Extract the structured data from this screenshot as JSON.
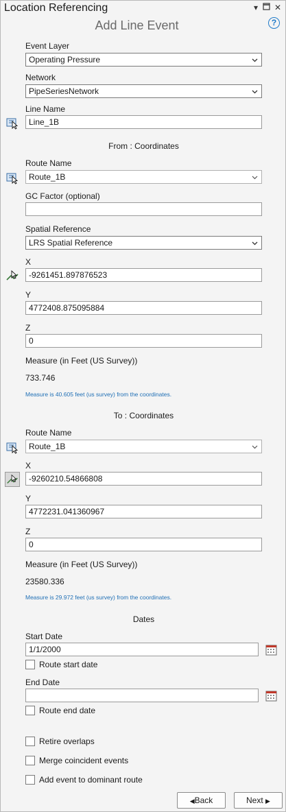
{
  "window": {
    "title": "Location Referencing",
    "subtitle": "Add Line Event",
    "help_label": "?"
  },
  "event_layer": {
    "label": "Event Layer",
    "value": "Operating Pressure"
  },
  "network": {
    "label": "Network",
    "value": "PipeSeriesNetwork"
  },
  "line_name": {
    "label": "Line Name",
    "value": "Line_1B"
  },
  "from": {
    "heading": "From : Coordinates",
    "route_label": "Route Name",
    "route_value": "Route_1B",
    "gc_label": "GC Factor (optional)",
    "gc_value": "",
    "sr_label": "Spatial Reference",
    "sr_value": "LRS Spatial Reference",
    "x_label": "X",
    "x_value": "-9261451.897876523",
    "y_label": "Y",
    "y_value": "4772408.875095884",
    "z_label": "Z",
    "z_value": "0",
    "measure_label": "Measure (in Feet (US Survey))",
    "measure_value": "733.746",
    "measure_note": "Measure is 40.605 feet (us survey) from the coordinates."
  },
  "to": {
    "heading": "To : Coordinates",
    "route_label": "Route Name",
    "route_value": "Route_1B",
    "x_label": "X",
    "x_value": "-9260210.54866808",
    "y_label": "Y",
    "y_value": "4772231.041360967",
    "z_label": "Z",
    "z_value": "0",
    "measure_label": "Measure (in Feet (US Survey))",
    "measure_value": "23580.336",
    "measure_note": "Measure is 29.972 feet (us survey) from the coordinates."
  },
  "dates": {
    "heading": "Dates",
    "start_label": "Start Date",
    "start_value": "1/1/2000",
    "route_start_label": "Route start date",
    "end_label": "End Date",
    "end_value": "",
    "route_end_label": "Route end date"
  },
  "options": {
    "retire_overlaps": "Retire overlaps",
    "merge_coincident": "Merge coincident events",
    "dominant_route": "Add event to dominant route"
  },
  "buttons": {
    "back": "Back",
    "next": "Next"
  },
  "colors": {
    "accent": "#1f7ac9",
    "note": "#1f6fb5",
    "calendar_red": "#c0392b"
  }
}
